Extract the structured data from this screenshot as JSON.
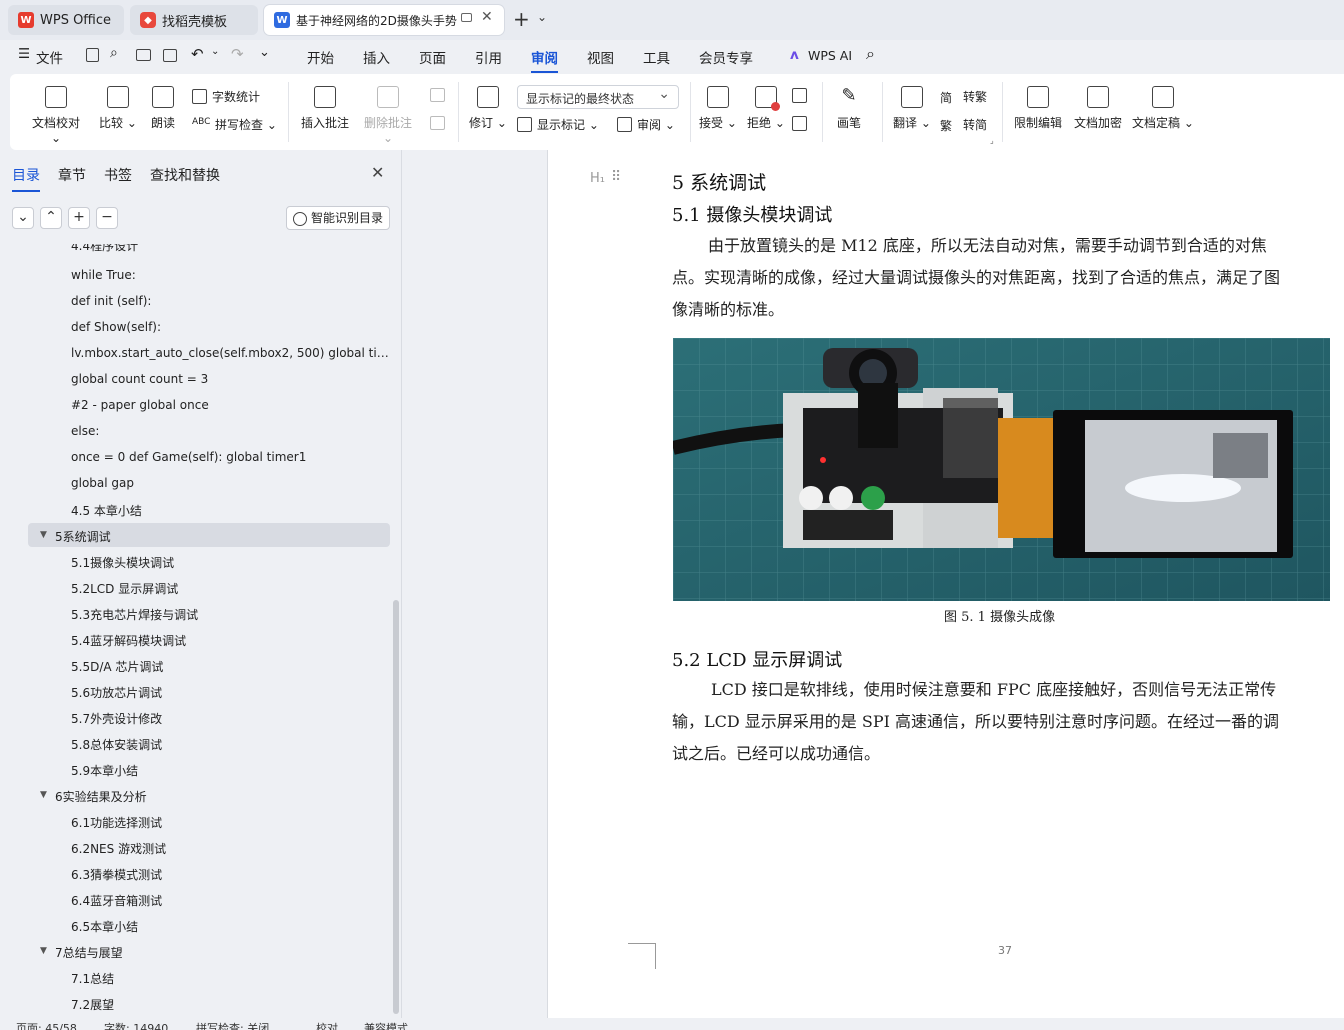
{
  "titlebar": {
    "tabs": [
      {
        "label": "WPS Office"
      },
      {
        "label": "找稻壳模板"
      },
      {
        "label": "基于神经网络的2D摄像头手势"
      }
    ],
    "new_tab": "+"
  },
  "menu": {
    "file": "文件",
    "items": [
      "开始",
      "插入",
      "页面",
      "引用",
      "审阅",
      "视图",
      "工具",
      "会员专享"
    ],
    "active": "审阅",
    "ai": "WPS AI"
  },
  "ribbon": {
    "doc_proofread": "文档校对",
    "compare": "比较",
    "read_aloud": "朗读",
    "word_count": "字数统计",
    "spell_check": "拼写检查",
    "insert_comment": "插入批注",
    "delete_comment": "删除批注",
    "track_changes": "修订",
    "markup_state": "显示标记的最终状态",
    "show_markup": "显示标记",
    "review": "审阅",
    "accept": "接受",
    "reject": "拒绝",
    "pen": "画笔",
    "translate": "翻译",
    "to_traditional": "转繁",
    "to_simplified": "转简",
    "restrict_edit": "限制编辑",
    "encrypt": "文档加密",
    "finalize": "文档定稿"
  },
  "sidebar": {
    "tabs": [
      "目录",
      "章节",
      "书签",
      "查找和替换"
    ],
    "smart_toc": "智能识别目录",
    "toc": [
      {
        "text": "4.4程序设计",
        "level": 2
      },
      {
        "text": "while True:",
        "level": 2
      },
      {
        "text": "def init (self):",
        "level": 2
      },
      {
        "text": "def Show(self):",
        "level": 2
      },
      {
        "text": "lv.mbox.start_auto_close(self.mbox2, 500) global ti…",
        "level": 2
      },
      {
        "text": "global count count = 3",
        "level": 2
      },
      {
        "text": "#2 - paper global once",
        "level": 2
      },
      {
        "text": "else:",
        "level": 2
      },
      {
        "text": "once = 0 def Game(self): global timer1",
        "level": 2
      },
      {
        "text": "global gap",
        "level": 2
      },
      {
        "text": "4.5 本章小结",
        "level": 2
      },
      {
        "text": "5系统调试",
        "level": 1
      },
      {
        "text": "5.1摄像头模块调试",
        "level": 2
      },
      {
        "text": "5.2LCD 显示屏调试",
        "level": 2
      },
      {
        "text": "5.3充电芯片焊接与调试",
        "level": 2
      },
      {
        "text": "5.4蓝牙解码模块调试",
        "level": 2
      },
      {
        "text": "5.5D/A 芯片调试",
        "level": 2
      },
      {
        "text": "5.6功放芯片调试",
        "level": 2
      },
      {
        "text": "5.7外壳设计修改",
        "level": 2
      },
      {
        "text": "5.8总体安装调试",
        "level": 2
      },
      {
        "text": "5.9本章小结",
        "level": 2
      },
      {
        "text": "6实验结果及分析",
        "level": 1
      },
      {
        "text": "6.1功能选择测试",
        "level": 2
      },
      {
        "text": "6.2NES 游戏测试",
        "level": 2
      },
      {
        "text": "6.3猜拳模式测试",
        "level": 2
      },
      {
        "text": "6.4蓝牙音箱测试",
        "level": 2
      },
      {
        "text": "6.5本章小结",
        "level": 2
      },
      {
        "text": "7总结与展望",
        "level": 1
      },
      {
        "text": "7.1总结",
        "level": 2
      },
      {
        "text": "7.2展望",
        "level": 2
      }
    ]
  },
  "document": {
    "h1": "5  系统调试",
    "h2_1": "5.1   摄像头模块调试",
    "p1": [
      "由于放置镜头的是 M12 底座，所以无法自动对焦，需要手动调节到合适的对焦",
      "点。实现清晰的成像，经过大量调试摄像头的对焦距离，找到了合适的焦点，满足了图",
      "像清晰的标准。"
    ],
    "caption": "图  5. 1 摄像头成像",
    "h2_2": "5.2   LCD 显示屏调试",
    "p2": [
      "LCD 接口是软排线，使用时候注意要和 FPC 底座接触好，否则信号无法正常传",
      "输，LCD 显示屏采用的是 SPI 高速通信，所以要特别注意时序问题。在经过一番的调",
      "试之后。已经可以成功通信。"
    ],
    "page_number": "37"
  },
  "status": {
    "page": "页面: 45/58",
    "words": "字数: 14940",
    "spell": "拼写检查: 关闭",
    "proof": "校对",
    "compat": "兼容模式"
  },
  "colors": {
    "accent": "#1a55d6",
    "wps_red": "#e63b2e"
  }
}
